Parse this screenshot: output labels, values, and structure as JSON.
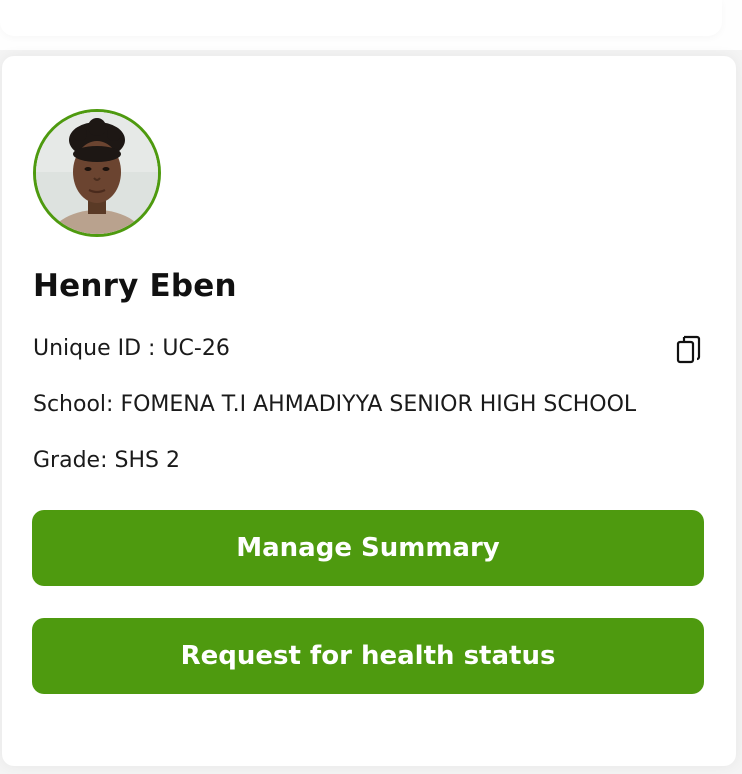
{
  "profile": {
    "avatar_alt": "Profile photo",
    "name": "Henry Eben",
    "unique_id": "Unique ID : UC-26",
    "school": "School: FOMENA T.I AHMADIYYA SENIOR HIGH SCHOOL",
    "grade": "Grade: SHS 2"
  },
  "actions": {
    "copy_icon": "copy-icon",
    "manage_summary": "Manage Summary",
    "request_health": "Request for health status"
  },
  "colors": {
    "accent": "#4e9a0f",
    "card_bg": "#ffffff",
    "page_bg": "#f4f4f4",
    "text": "#1a1a1a"
  }
}
